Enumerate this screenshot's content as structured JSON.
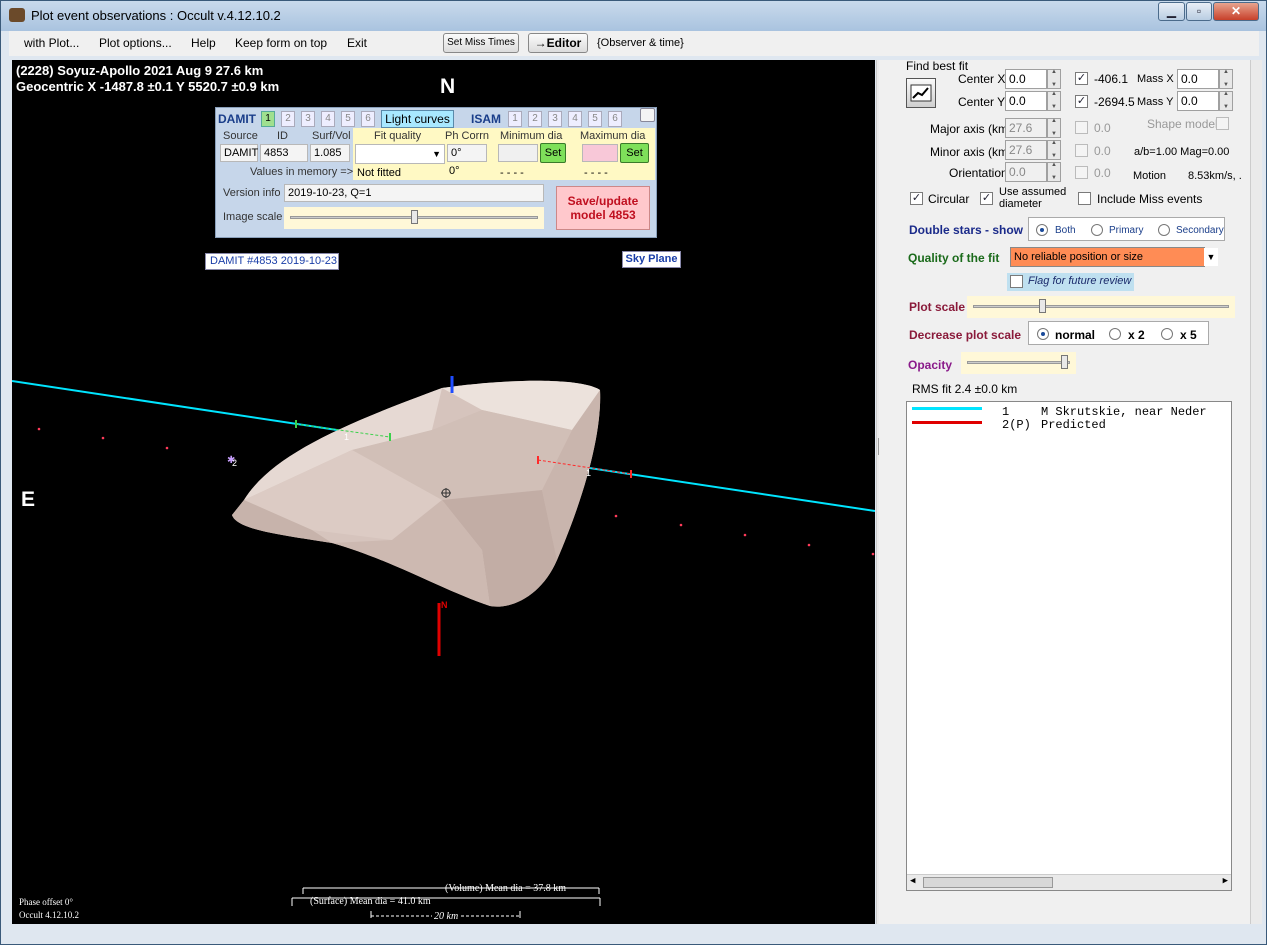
{
  "window": {
    "title": "Plot event observations : Occult v.4.12.10.2"
  },
  "menu": {
    "items": [
      "with Plot...",
      "Plot options...",
      "Help",
      "Keep form on top",
      "Exit"
    ],
    "set_miss_times": "Set Miss Times",
    "editor": "→Editor",
    "observer_time": "{Observer & time}"
  },
  "plot": {
    "header_line1": "(2228) Soyuz-Apollo  2021 Aug 9   27.6 km",
    "header_line2": "Geocentric  X  -1487.8 ±0.1  Y 5520.7 ±0.9 km",
    "north": "N",
    "east": "E",
    "damit_label": "DAMIT #4853 2019-10-23",
    "sky_plane": "Sky Plane",
    "chord_label_1": "1",
    "chord_label_2": "2",
    "chord_label_1b": "1",
    "north_axis_label": "N",
    "volume_mean": "(Volume) Mean dia = 37.8 km",
    "surface_mean": "(Surface) Mean dia = 41.0 km",
    "scale_bar": "20 km",
    "phase_offset": "Phase offset 0°",
    "version": "Occult 4.12.10.2"
  },
  "damit_panel": {
    "damit": "DAMIT",
    "isam": "ISAM",
    "numbers": [
      "1",
      "2",
      "3",
      "4",
      "5",
      "6"
    ],
    "light_curves": "Light curves",
    "source_hdr": "Source",
    "id_hdr": "ID",
    "surfvol_hdr": "Surf/Vol",
    "source": "DAMIT",
    "id": "4853",
    "surfvol": "1.085",
    "fit_quality_hdr": "Fit quality",
    "ph_corrn_hdr": "Ph Corrn",
    "min_dia_hdr": "Minimum dia",
    "max_dia_hdr": "Maximum dia",
    "ph_corrn": "0°",
    "set": "Set",
    "values_in_memory": "Values in memory =>",
    "not_fitted": "Not fitted",
    "mem_ph": "0°",
    "mem_min": "- - - -",
    "mem_max": "- - - -",
    "version_info_label": "Version info",
    "version_info": "2019-10-23, Q=1",
    "image_scale_label": "Image scale",
    "save_update": "Save/update model 4853"
  },
  "right_panel": {
    "find_best_fit": "Find best fit",
    "center_x_label": "Center X",
    "center_x": "0.0",
    "center_y_label": "Center Y",
    "center_y": "0.0",
    "fit_x": "-406.1",
    "fit_y": "-2694.5",
    "mass_x_label": "Mass X",
    "mass_x": "0.0",
    "mass_y_label": "Mass Y",
    "mass_y": "0.0",
    "major_axis_label": "Major axis (km)",
    "major_axis": "27.6",
    "minor_axis_label": "Minor axis (km)",
    "minor_axis": "27.6",
    "orientation_label": "Orientation",
    "orientation": "0.0",
    "dis_val_1": "0.0",
    "dis_val_2": "0.0",
    "dis_val_3": "0.0",
    "shape_model": "Shape model",
    "ab_mag": "a/b=1.00  Mag=0.00",
    "motion_label": "Motion",
    "motion": "8.53km/s, .",
    "circular": "Circular",
    "use_assumed": "Use assumed diameter",
    "include_miss": "Include Miss events",
    "double_stars": "Double stars - show",
    "both": "Both",
    "primary": "Primary",
    "secondary": "Secondary",
    "quality_label": "Quality of the fit",
    "quality_value": "No reliable position or size",
    "flag_review": "Flag for future review",
    "plot_scale": "Plot scale",
    "decrease_scale": "Decrease plot scale",
    "normal": "normal",
    "x2": "x 2",
    "x5": "x 5",
    "opacity": "Opacity",
    "rms_fit": "RMS fit 2.4 ±0.0 km"
  },
  "legend": [
    {
      "num": "1",
      "name": "M Skrutskie, near Neder",
      "color": "#00e5ff"
    },
    {
      "num": "2(P)",
      "name": "Predicted",
      "color": "#e00000"
    }
  ],
  "colors": {
    "accent_green": "#7ee05a",
    "chord_cyan": "#00e5ff",
    "quality_orange": "#ff8c55"
  }
}
